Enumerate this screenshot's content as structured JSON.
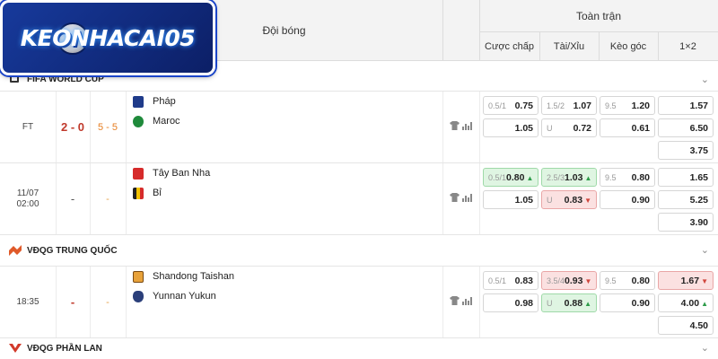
{
  "logo": {
    "text": "KEONHACAI05"
  },
  "header": {
    "team_col": "Đội bóng",
    "full_match": "Toàn trận",
    "cols": [
      "Cược chấp",
      "Tài/Xỉu",
      "Kèo góc",
      "1×2"
    ]
  },
  "leagues": [
    {
      "name": "FIFA WORLD CUP",
      "chevron": "⌄"
    },
    {
      "name": "VĐQG TRUNG QUỐC",
      "chevron": "⌄"
    },
    {
      "name": "VĐQG PHẦN LAN",
      "chevron": "⌄"
    }
  ],
  "matches": [
    {
      "time": "FT",
      "time2": "",
      "score": "2 - 0",
      "corners": "5 - 5",
      "home": "Pháp",
      "away": "Maroc",
      "handicap": {
        "line": "0.5/1",
        "home": "0.75",
        "away": "1.05"
      },
      "totals": {
        "line": "1.5/2",
        "over": "1.07",
        "under_label": "U",
        "under": "0.72"
      },
      "corner": {
        "line": "9.5",
        "over": "1.20",
        "under": "0.61"
      },
      "x12": [
        "1.57",
        "6.50",
        "3.75"
      ]
    },
    {
      "time": "11/07",
      "time2": "02:00",
      "score": "-",
      "corners": "-",
      "home": "Tây Ban Nha",
      "away": "Bỉ",
      "handicap": {
        "line": "0.5/1",
        "home": "0.80",
        "away": "1.05"
      },
      "totals": {
        "line": "2.5/3",
        "over": "1.03",
        "under_label": "U",
        "under": "0.83"
      },
      "corner": {
        "line": "9.5",
        "over": "0.80",
        "under": "0.90"
      },
      "x12": [
        "1.65",
        "5.25",
        "3.90"
      ]
    },
    {
      "time": "18:35",
      "time2": "",
      "score": "-",
      "corners": "-",
      "home": "Shandong Taishan",
      "away": "Yunnan Yukun",
      "handicap": {
        "line": "0.5/1",
        "home": "0.83",
        "away": "0.98"
      },
      "totals": {
        "line": "3.5/4",
        "over": "0.93",
        "under_label": "U",
        "under": "0.88"
      },
      "corner": {
        "line": "9.5",
        "over": "0.80",
        "under": "0.90"
      },
      "x12": [
        "1.67",
        "4.00",
        "4.50"
      ]
    }
  ],
  "arrows": {
    "up": "▲",
    "down": "▼"
  },
  "icons": {
    "shirt": "shirt-icon",
    "stats": "stats-icon"
  },
  "colors": {
    "score_red": "#c0392b",
    "corner_orange": "#e67e22",
    "up_bg": "#dff5e2",
    "down_bg": "#fbe1e1"
  }
}
